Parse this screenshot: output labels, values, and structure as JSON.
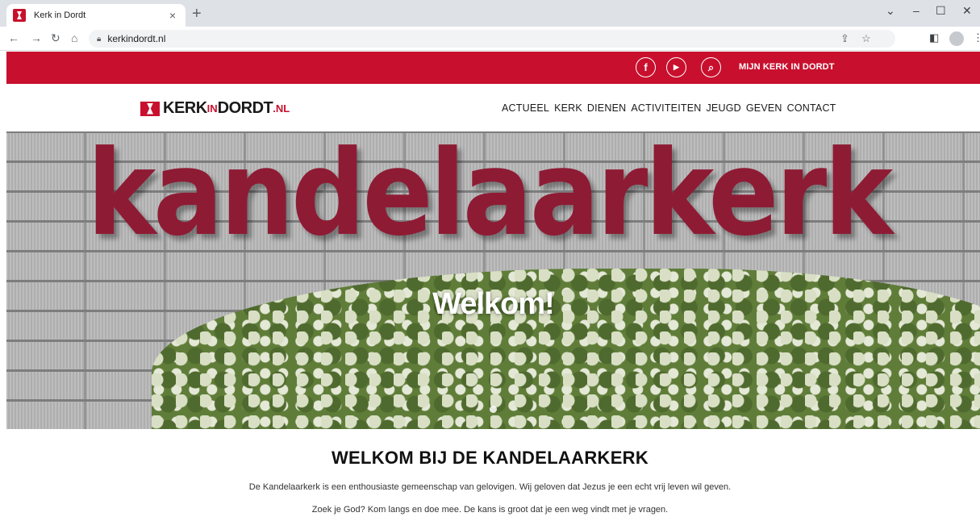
{
  "browser": {
    "tab_title": "Kerk in Dordt",
    "tab_close": "×",
    "new_tab": "+",
    "url": "kerkindordt.nl",
    "window_controls": [
      "⌄",
      "–",
      "☐",
      "✕"
    ]
  },
  "topbar": {
    "social": [
      {
        "name": "facebook-icon",
        "glyph": "f"
      },
      {
        "name": "youtube-icon",
        "glyph": "▶"
      },
      {
        "name": "search-icon",
        "glyph": "⌕"
      }
    ],
    "account_link": "MIJN KERK IN DORDT",
    "bg_color": "#c8102e"
  },
  "header": {
    "logo": {
      "part1": "KERK",
      "part2": "IN",
      "part3": "DORDT",
      "part4": ".NL"
    },
    "menu": [
      "ACTUEEL",
      "KERK",
      "DIENEN",
      "ACTIVITEITEN",
      "JEUGD",
      "GEVEN",
      "CONTACT"
    ]
  },
  "hero": {
    "sign_text": "kandelaarkerk",
    "title": "Welkom!"
  },
  "content": {
    "heading": "WELKOM BIJ DE KANDELAARKERK",
    "paragraphs": [
      "De Kandelaarkerk is een enthousiaste gemeenschap van gelovigen. Wij geloven dat Jezus je een echt vrij leven wil geven.",
      "Zoek je God? Kom langs en doe mee. De kans is groot dat je een weg vindt met je vragen."
    ]
  }
}
